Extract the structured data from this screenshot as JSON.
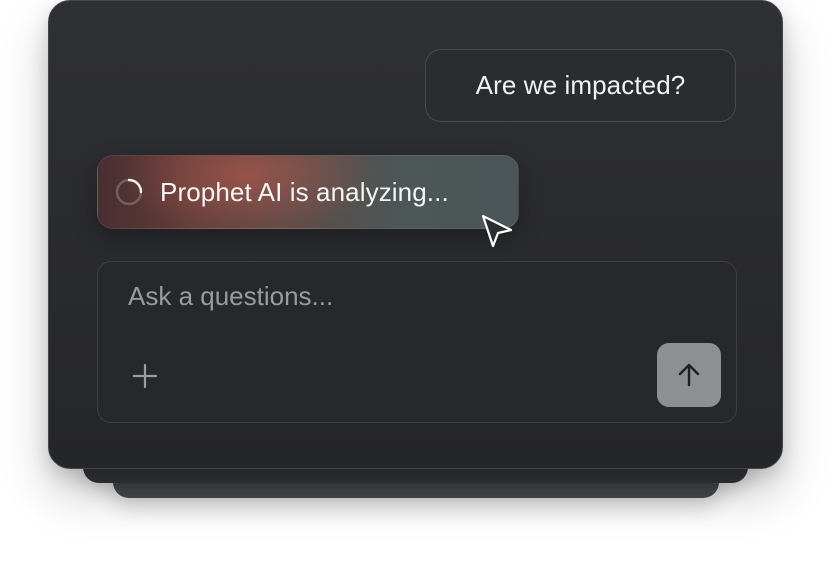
{
  "chat": {
    "user_message": "Are we impacted?",
    "status_message": "Prophet AI is analyzing..."
  },
  "composer": {
    "placeholder": "Ask a questions...",
    "value": "",
    "attach_icon": "plus-icon",
    "send_icon": "arrow-up-icon"
  },
  "icons": {
    "status_indicator": "spinner-icon",
    "pointer": "cursor-pointer-icon"
  },
  "colors": {
    "card_background": "#2a2b2e",
    "send_button": "#8e8f91",
    "status_gradient_warm": "#5f3d3b",
    "status_gradient_cool": "#4a5658"
  }
}
